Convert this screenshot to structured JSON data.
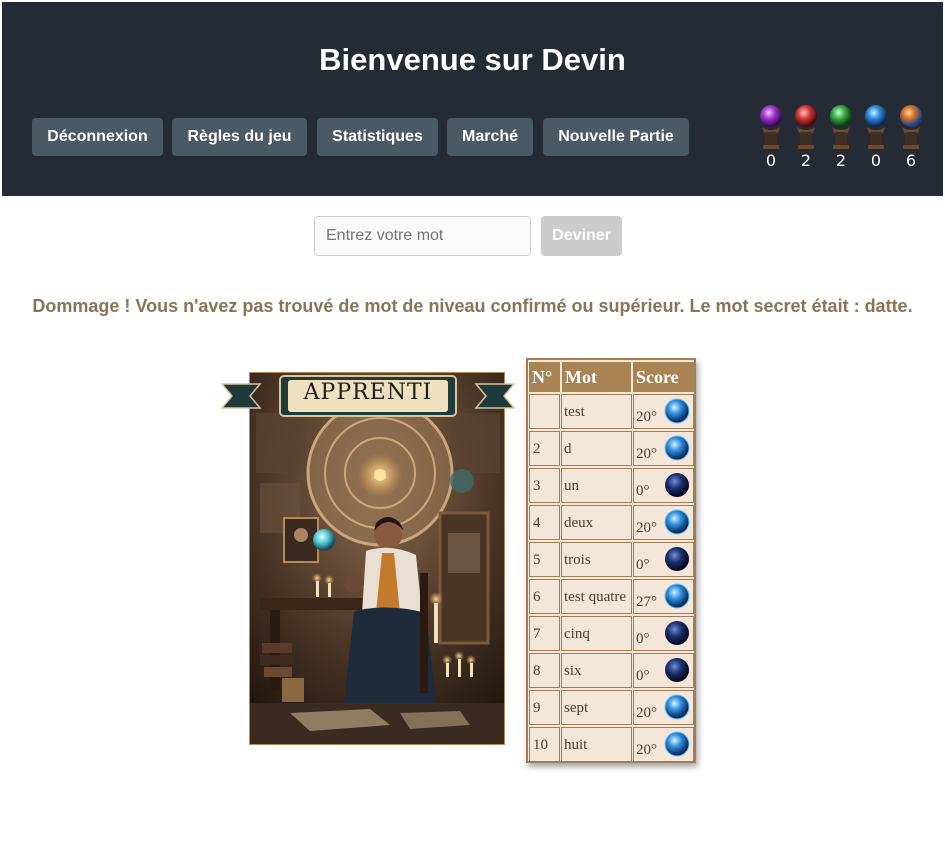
{
  "header": {
    "title": "Bienvenue sur Devin",
    "nav": [
      "Déconnexion",
      "Règles du jeu",
      "Statistiques",
      "Marché",
      "Nouvelle Partie"
    ],
    "orbs": [
      {
        "icon": "purple-orb-icon",
        "color": "#a03ad2",
        "count": "0"
      },
      {
        "icon": "red-orb-icon",
        "color": "#d83a3a",
        "count": "2"
      },
      {
        "icon": "green-orb-icon",
        "color": "#3fae4a",
        "count": "2"
      },
      {
        "icon": "blue-orb-icon",
        "color": "#2f8ee0",
        "count": "0"
      },
      {
        "icon": "orange-blue-orb-icon",
        "color": "#2b6fd6",
        "count": "6"
      }
    ]
  },
  "guess": {
    "placeholder": "Entrez votre mot",
    "button": "Deviner"
  },
  "message": "Dommage ! Vous n'avez pas trouvé de mot de niveau confirmé ou supérieur. Le mot secret était : datte.",
  "card": {
    "banner": "APPRENTI"
  },
  "table": {
    "headers": {
      "n": "N°",
      "word": "Mot",
      "score": "Score"
    },
    "rows": [
      {
        "n": "",
        "word": "test",
        "score": "20°",
        "orb": "bright"
      },
      {
        "n": "2",
        "word": "d",
        "score": "20°",
        "orb": "bright"
      },
      {
        "n": "3",
        "word": "un",
        "score": "0°",
        "orb": "dark"
      },
      {
        "n": "4",
        "word": "deux",
        "score": "20°",
        "orb": "bright"
      },
      {
        "n": "5",
        "word": "trois",
        "score": "0°",
        "orb": "dark"
      },
      {
        "n": "6",
        "word": "test quatre",
        "score": "27°",
        "orb": "bright"
      },
      {
        "n": "7",
        "word": "cinq",
        "score": "0°",
        "orb": "dark"
      },
      {
        "n": "8",
        "word": "six",
        "score": "0°",
        "orb": "dark"
      },
      {
        "n": "9",
        "word": "sept",
        "score": "20°",
        "orb": "bright"
      },
      {
        "n": "10",
        "word": "huit",
        "score": "20°",
        "orb": "bright"
      }
    ]
  }
}
